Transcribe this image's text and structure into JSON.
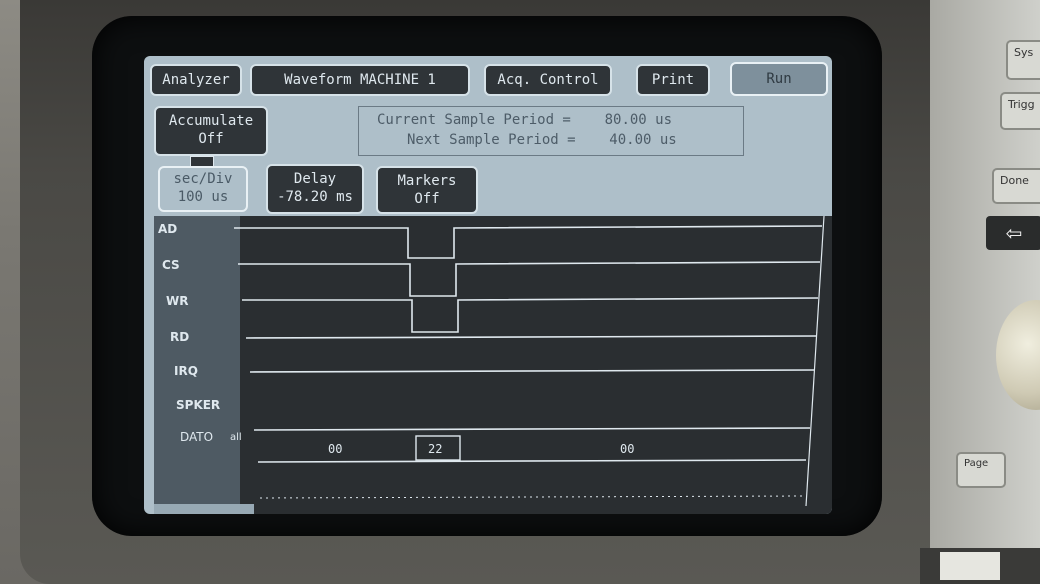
{
  "toolbar": {
    "analyzer": "Analyzer",
    "waveform": "Waveform MACHINE 1",
    "acq_control": "Acq. Control",
    "print": "Print",
    "run": "Run"
  },
  "accumulate": {
    "label": "Accumulate",
    "value": "Off"
  },
  "sample_period": {
    "current_label": "Current Sample Period =",
    "current_value": "80.00 us",
    "next_label": "Next Sample Period =",
    "next_value": "40.00 us"
  },
  "sec_div": {
    "label": "sec/Div",
    "value": "100 us"
  },
  "delay": {
    "label": "Delay",
    "value": "-78.20 ms"
  },
  "markers": {
    "label": "Markers",
    "value": "Off"
  },
  "signals": [
    "AD",
    "CS",
    "WR",
    "RD",
    "IRQ",
    "SPKER",
    "DATO"
  ],
  "dato_suffix": "all",
  "bus_values": [
    "00",
    "22",
    "00"
  ],
  "front_panel": {
    "sys": "Sys",
    "trig": "Trigg",
    "done": "Done",
    "back": "⇦",
    "page": "Page"
  },
  "colors": {
    "screen_bg": "#aebfc9",
    "wave_bg": "#2a2e31",
    "trace": "#dfe8ee"
  }
}
